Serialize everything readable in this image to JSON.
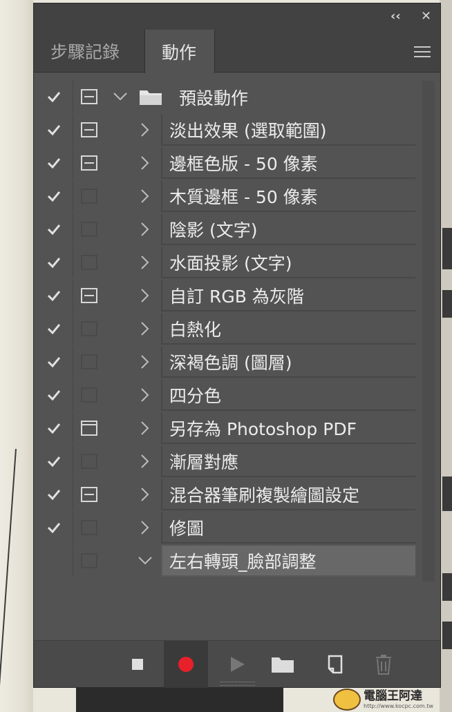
{
  "tabs": {
    "history": "步驟記錄",
    "actions": "動作"
  },
  "action_set": {
    "name": "預設動作",
    "checked": true,
    "dialog": "lined",
    "expanded": true
  },
  "actions": [
    {
      "name": "淡出效果 (選取範圍)",
      "checked": true,
      "dialog": "lined"
    },
    {
      "name": "邊框色版 - 50 像素",
      "checked": true,
      "dialog": "lined"
    },
    {
      "name": "木質邊框 - 50 像素",
      "checked": true,
      "dialog": "empty"
    },
    {
      "name": "陰影 (文字)",
      "checked": true,
      "dialog": "empty"
    },
    {
      "name": "水面投影 (文字)",
      "checked": true,
      "dialog": "empty"
    },
    {
      "name": "自訂 RGB 為灰階",
      "checked": true,
      "dialog": "lined"
    },
    {
      "name": "白熱化",
      "checked": true,
      "dialog": "empty"
    },
    {
      "name": "深褐色調 (圖層)",
      "checked": true,
      "dialog": "empty"
    },
    {
      "name": "四分色",
      "checked": true,
      "dialog": "empty"
    },
    {
      "name": "另存為 Photoshop PDF",
      "checked": true,
      "dialog": "top-line"
    },
    {
      "name": "漸層對應",
      "checked": true,
      "dialog": "empty"
    },
    {
      "name": "混合器筆刷複製繪圖設定",
      "checked": true,
      "dialog": "lined"
    },
    {
      "name": "修圖",
      "checked": true,
      "dialog": "empty"
    },
    {
      "name": "左右轉頭_臉部調整",
      "checked": false,
      "dialog": "empty",
      "selected": true,
      "expanded": true
    }
  ],
  "footer_buttons": [
    "stop-icon",
    "record-icon",
    "play-icon",
    "folder-icon",
    "new-action-icon",
    "trash-icon"
  ],
  "colors": {
    "panel": "#535353",
    "record": "#e8202a",
    "selected_row": "#686868"
  },
  "watermark": {
    "title": "電腦王阿達",
    "url": "http://www.kocpc.com.tw"
  }
}
